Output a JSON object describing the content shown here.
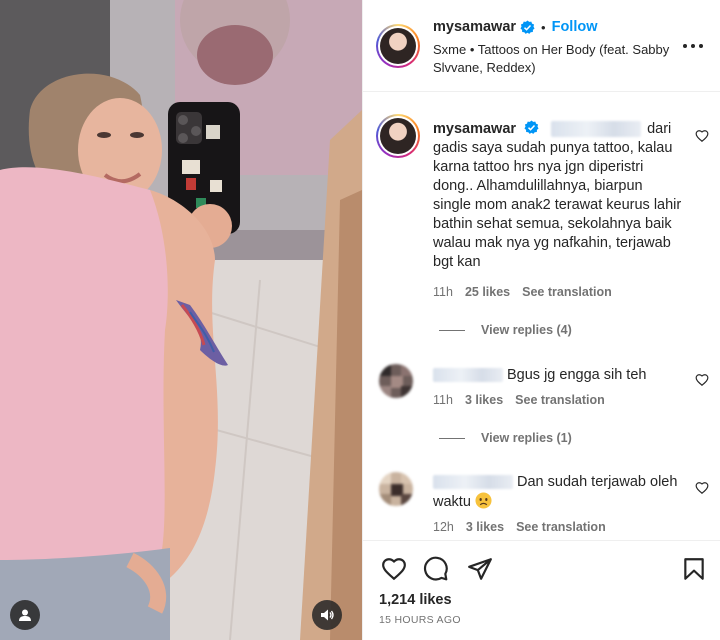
{
  "post": {
    "username": "mysamawar",
    "follow_label": "Follow",
    "separator": "•",
    "song": "Sxme • Tattoos on Her Body (feat. Sabby Slvvane, Reddex)"
  },
  "comments": [
    {
      "username": "mysamawar",
      "first_word": "dari",
      "text": "gadis saya sudah punya tattoo, kalau karna tattoo hrs nya jgn diperistri dong.. Alhamdulillahnya, biarpun single mom anak2 terawat keurus lahir bathin sehat semua, sekolahnya baik walau mak nya yg nafkahin, terjawab bgt kan",
      "time": "11h",
      "likes": "25 likes",
      "translate": "See translation",
      "replies": "View replies (4)"
    },
    {
      "text": "Bgus jg engga sih teh",
      "time": "11h",
      "likes": "3 likes",
      "translate": "See translation",
      "replies": "View replies (1)"
    },
    {
      "text": "Dan sudah terjawab oleh waktu",
      "emoji": "worried-face",
      "time": "12h",
      "likes": "3 likes",
      "translate": "See translation"
    }
  ],
  "footer": {
    "likes": "1,214 likes",
    "time_ago": "15 HOURS AGO"
  },
  "colors": {
    "accent": "#0095f6",
    "text": "#262626",
    "secondary": "#737373",
    "verified": "#0095f6"
  },
  "icons": {
    "header_more": "more-horizontal-icon",
    "comment_like": "heart-outline-icon",
    "like": "heart-outline-icon",
    "comment": "comment-bubble-icon",
    "share": "paper-plane-icon",
    "save": "bookmark-icon",
    "media_user": "user-tag-icon",
    "media_sound": "speaker-icon"
  }
}
